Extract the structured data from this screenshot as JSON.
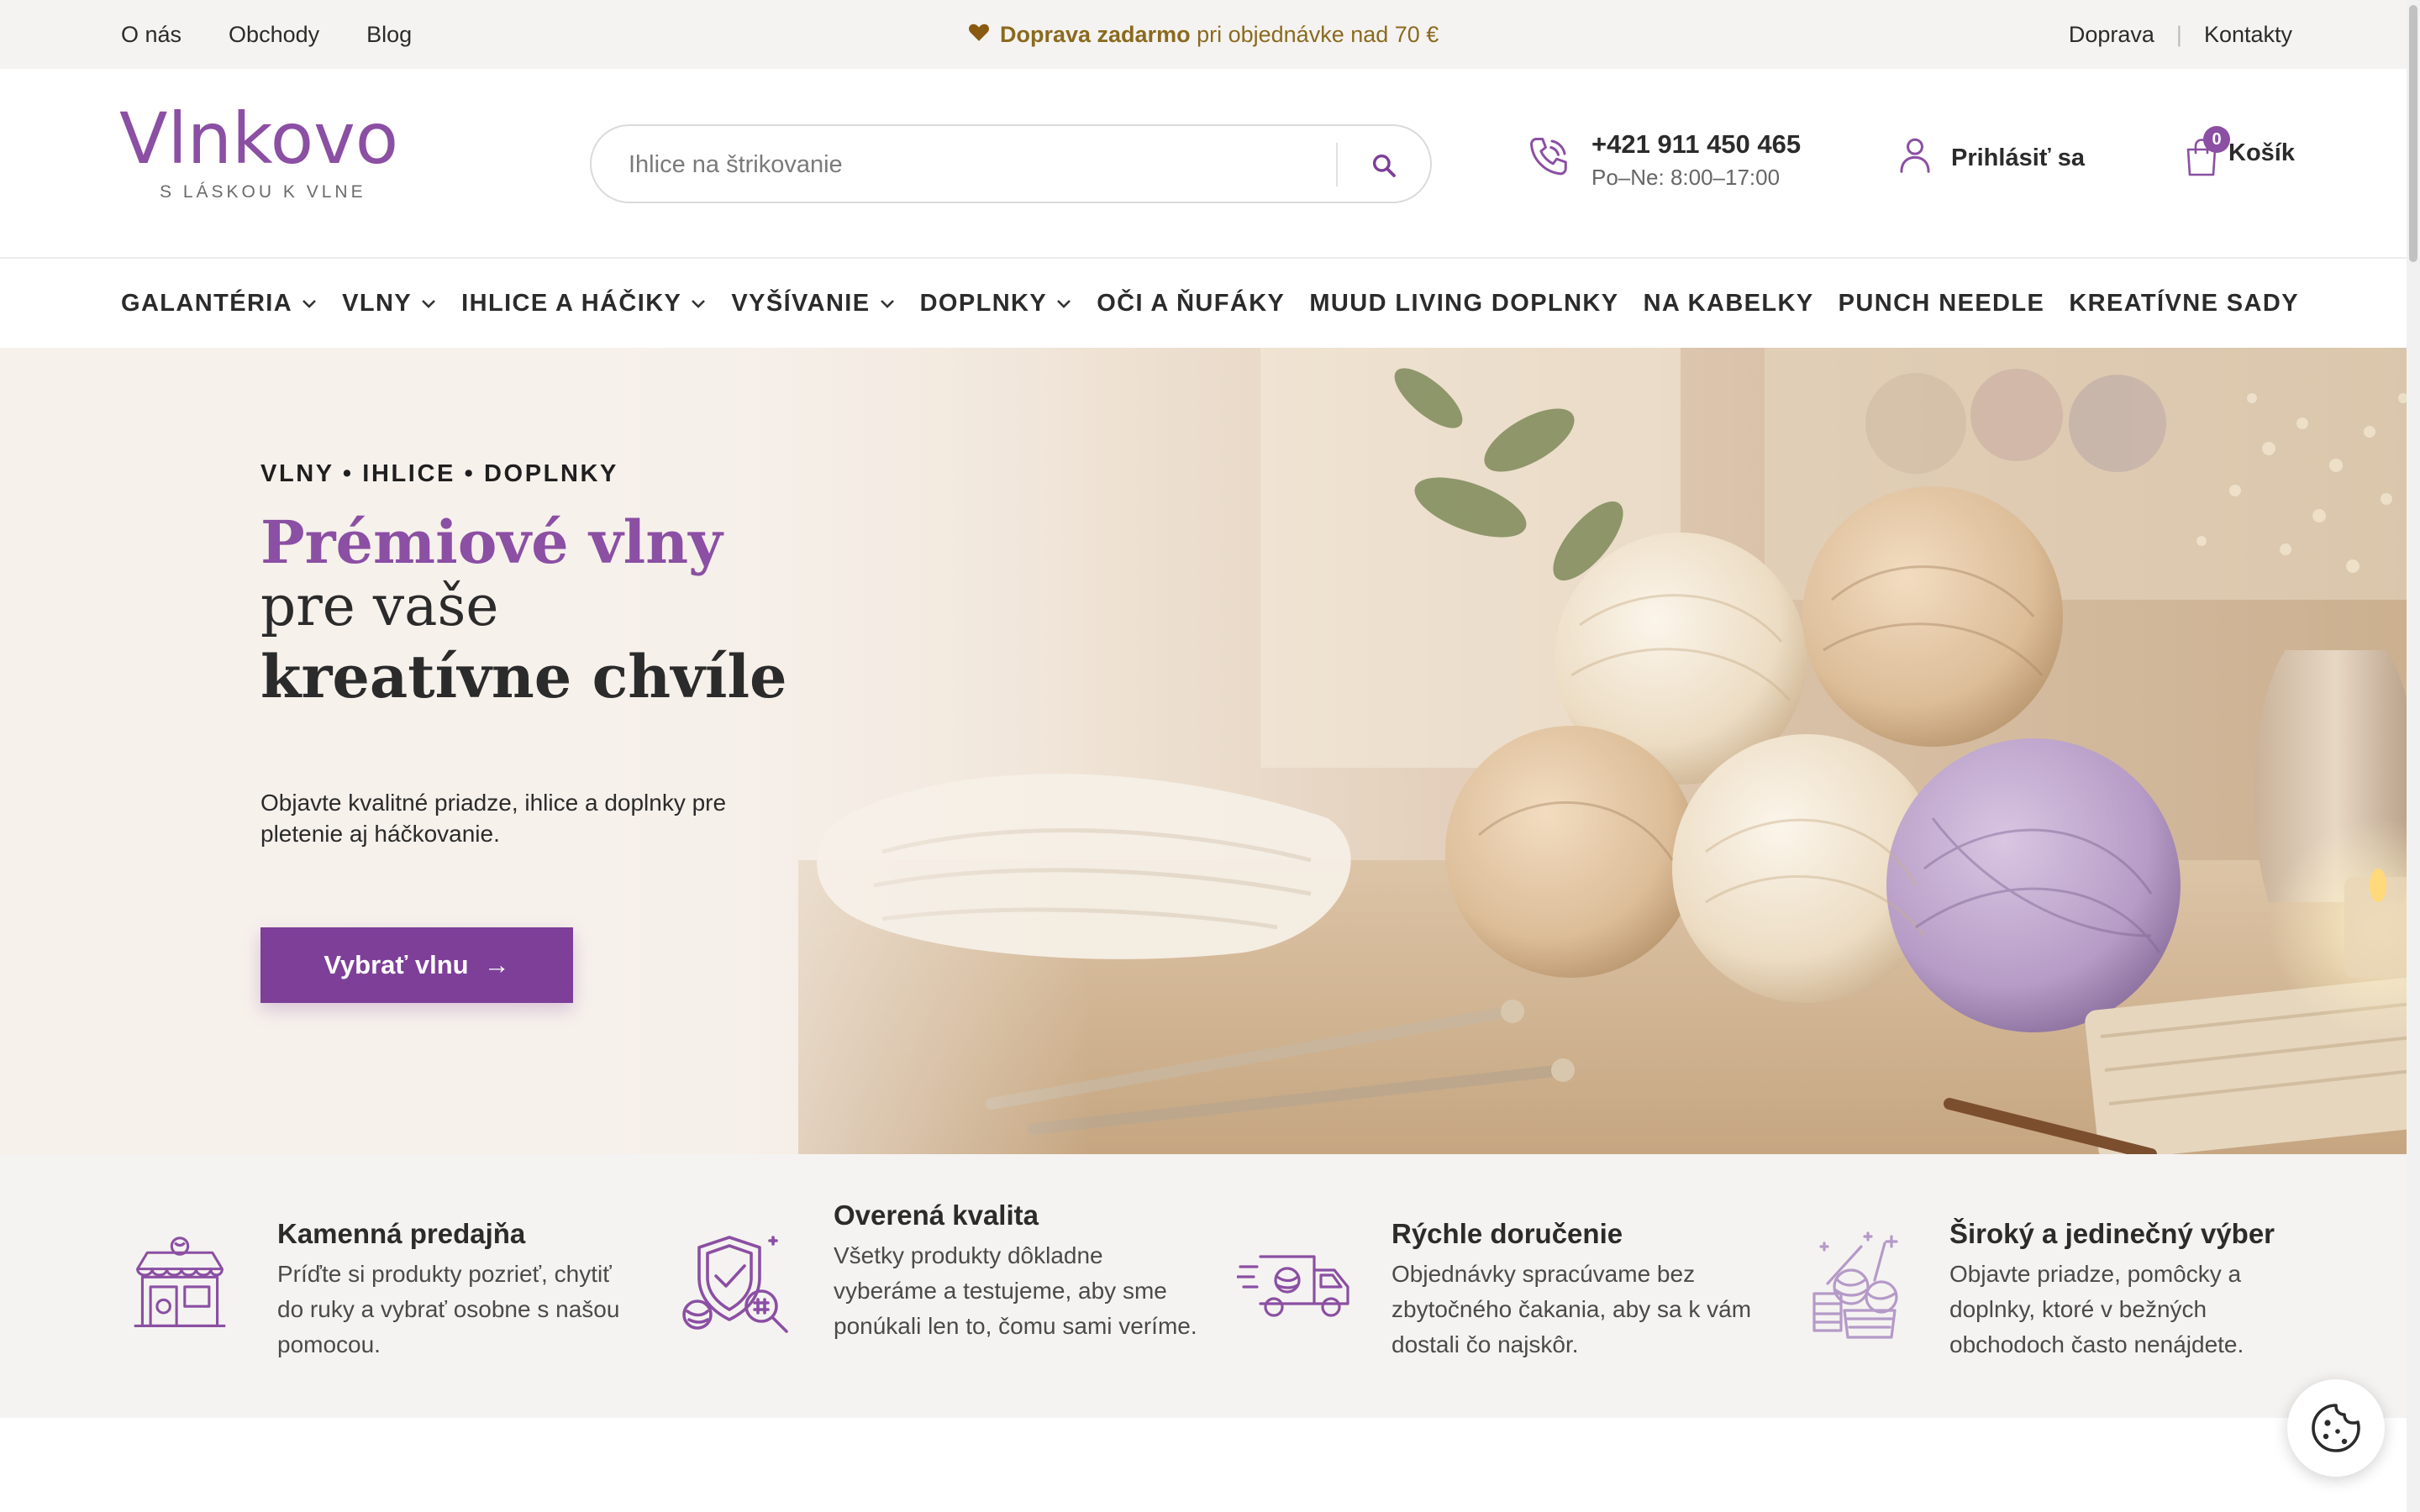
{
  "topbar": {
    "links": [
      "O nás",
      "Obchody",
      "Blog"
    ],
    "promo_bold": "Doprava zadarmo",
    "promo_rest": "pri objednávke nad 70 €",
    "right_links": [
      "Doprava",
      "Kontakty"
    ],
    "separator": "|"
  },
  "header": {
    "logo_text": "Vlnkovo",
    "logo_tagline": "S LÁSKOU K VLNE",
    "search_placeholder": "Ihlice na štrikovanie",
    "phone_number": "+421 911 450 465",
    "phone_hours": "Po–Ne: 8:00–17:00",
    "login_label": "Prihlásiť sa",
    "cart_label": "Košík",
    "cart_count": "0"
  },
  "nav": {
    "items": [
      {
        "label": "GALANTÉRIA",
        "dropdown": true
      },
      {
        "label": "VLNY",
        "dropdown": true
      },
      {
        "label": "IHLICE A HÁČIKY",
        "dropdown": true
      },
      {
        "label": "VYŠÍVANIE",
        "dropdown": true
      },
      {
        "label": "DOPLNKY",
        "dropdown": true
      },
      {
        "label": "OČI A ŇUFÁKY",
        "dropdown": false
      },
      {
        "label": "MUUD LIVING DOPLNKY",
        "dropdown": false
      },
      {
        "label": "NA KABELKY",
        "dropdown": false
      },
      {
        "label": "PUNCH NEEDLE",
        "dropdown": false
      },
      {
        "label": "KREATÍVNE SADY",
        "dropdown": false
      }
    ]
  },
  "hero": {
    "kicker": "VLNY • IHLICE • DOPLNKY",
    "title_line1": "Prémiové vlny",
    "title_line2": "pre vaše",
    "title_line3": "kreatívne chvíle",
    "description": "Objavte kvalitné priadze, ihlice a doplnky pre pletenie aj háčkovanie.",
    "cta_label": "Vybrať vlnu",
    "cta_arrow": "→"
  },
  "features": [
    {
      "title": "Kamenná predajňa",
      "text": "Príďte si produkty pozrieť, chytiť do ruky a vybrať osobne s našou pomocou.",
      "icon": "store-icon"
    },
    {
      "title": "Overená kvalita",
      "text": "Všetky produkty dôkladne vyberáme a testujeme, aby sme ponúkali len to, čomu sami veríme.",
      "icon": "quality-shield-icon"
    },
    {
      "title": "Rýchle doručenie",
      "text": "Objednávky spracúvame bez zbytočného čakania, aby sa k vám dostali čo najskôr.",
      "icon": "delivery-truck-icon"
    },
    {
      "title": "Široký a jedinečný výber",
      "text": "Objavte priadze, pomôcky a doplnky, ktoré v bežných obchodoch často nenájdete.",
      "icon": "yarn-basket-icon"
    }
  ],
  "colors": {
    "brand_purple": "#8b4fa3",
    "cta_purple": "#7d3f98",
    "promo_gold": "#8a6a1f",
    "topbar_bg": "#f5f3f1"
  }
}
